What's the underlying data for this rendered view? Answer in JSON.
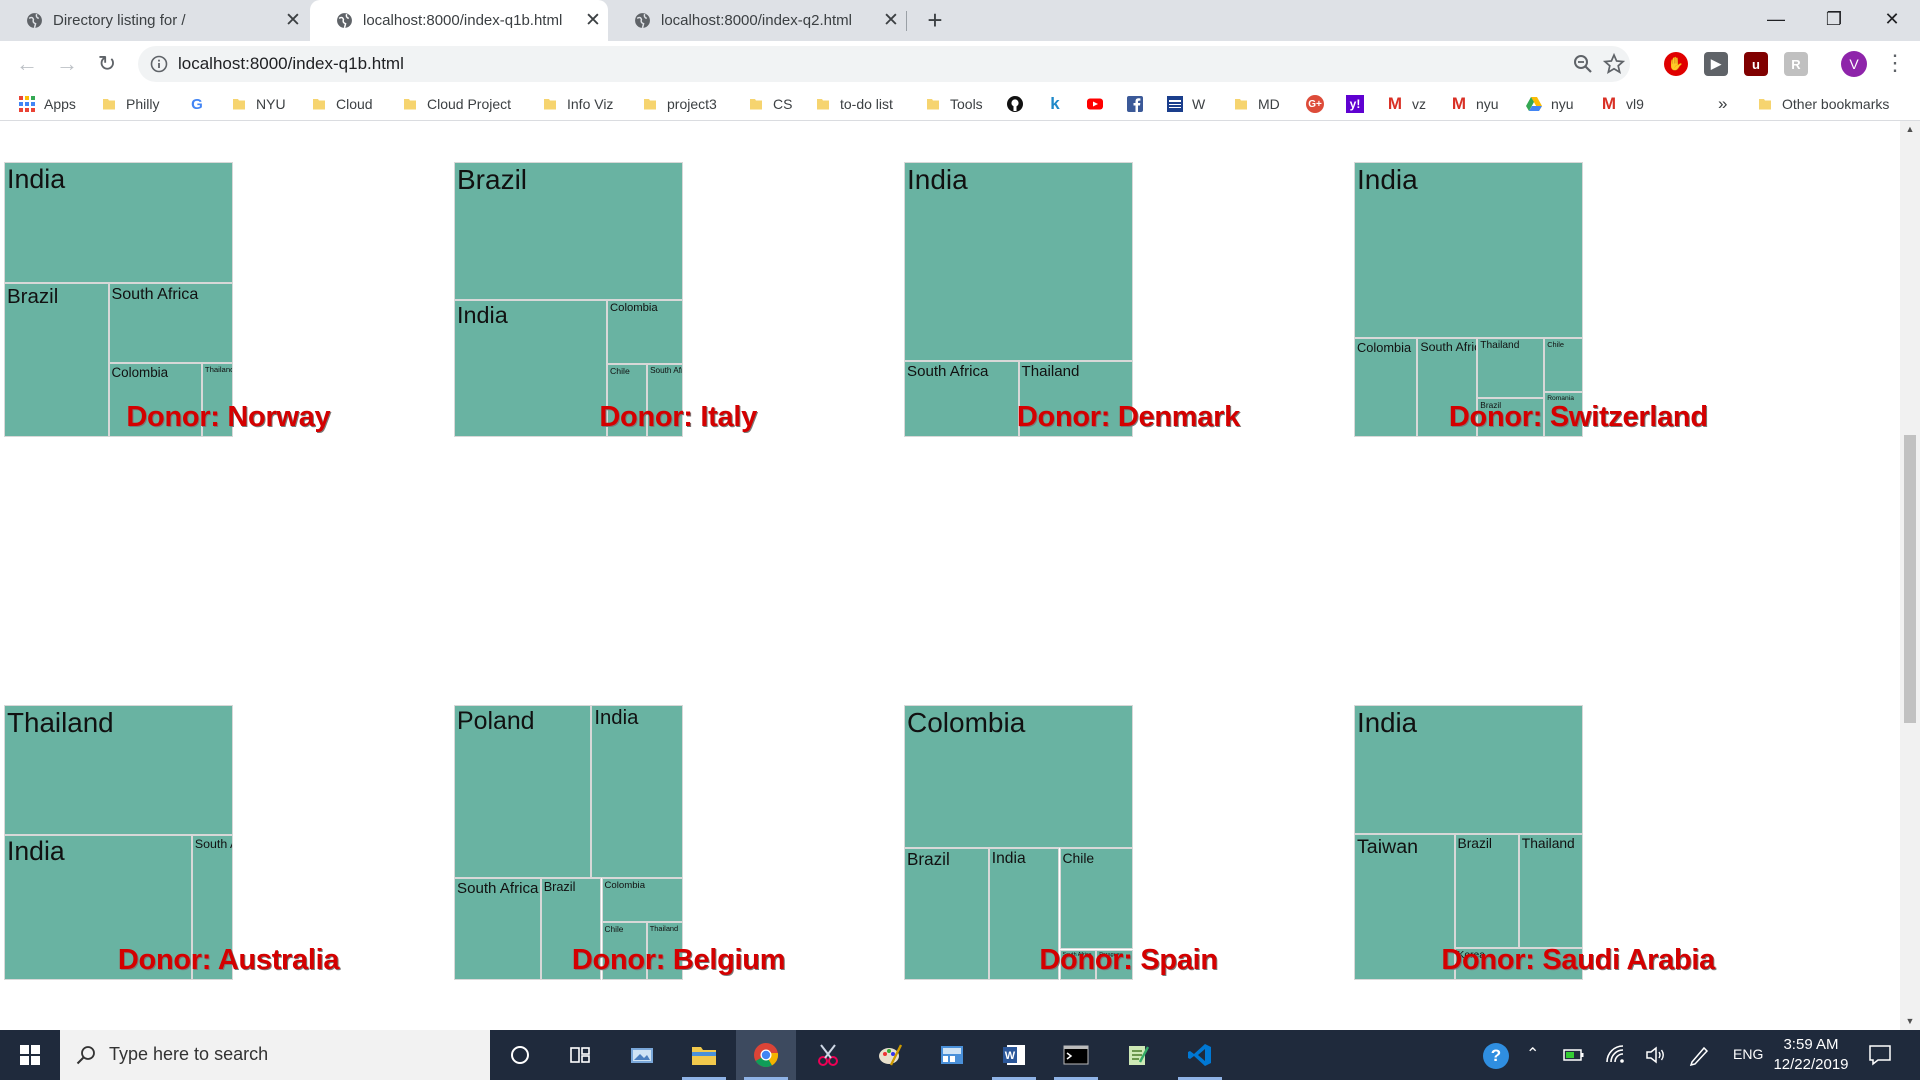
{
  "browser": {
    "tabs": [
      {
        "title": "Directory listing for /",
        "active": false
      },
      {
        "title": "localhost:8000/index-q1b.html",
        "active": true
      },
      {
        "title": "localhost:8000/index-q2.html",
        "active": false
      }
    ],
    "new_tab_label": "+",
    "url": "localhost:8000/index-q1b.html",
    "profile_initial": "V",
    "bookmarks": [
      {
        "label": "Apps",
        "icon": "apps-grid-icon"
      },
      {
        "label": "Philly",
        "icon": "folder-icon"
      },
      {
        "label": "",
        "icon": "google-icon"
      },
      {
        "label": "NYU",
        "icon": "folder-icon"
      },
      {
        "label": "Cloud",
        "icon": "folder-icon"
      },
      {
        "label": "Cloud Project",
        "icon": "folder-icon"
      },
      {
        "label": "Info Viz",
        "icon": "folder-icon"
      },
      {
        "label": "project3",
        "icon": "folder-icon"
      },
      {
        "label": "CS",
        "icon": "folder-icon"
      },
      {
        "label": "to-do list",
        "icon": "folder-icon"
      },
      {
        "label": "Tools",
        "icon": "folder-icon"
      },
      {
        "label": "",
        "icon": "github-icon"
      },
      {
        "label": "",
        "icon": "khan-icon"
      },
      {
        "label": "",
        "icon": "youtube-icon"
      },
      {
        "label": "",
        "icon": "facebook-icon"
      },
      {
        "label": "W",
        "icon": "news-icon"
      },
      {
        "label": "MD",
        "icon": "folder-icon"
      },
      {
        "label": "",
        "icon": "google-plus-icon"
      },
      {
        "label": "",
        "icon": "yahoo-icon"
      },
      {
        "label": "vz",
        "icon": "gmail-icon"
      },
      {
        "label": "nyu",
        "icon": "gmail-icon"
      },
      {
        "label": "nyu",
        "icon": "drive-icon"
      },
      {
        "label": "vl9",
        "icon": "gmail-icon"
      }
    ],
    "overflow_label": "»",
    "other_bookmarks": "Other bookmarks",
    "colors": {
      "tile": "#69b3a2",
      "donor_label": "#d40000",
      "tab_strip": "#dee1e6"
    }
  },
  "chart_data": [
    {
      "type": "treemap",
      "title": "Donor: Norway",
      "cells": [
        {
          "name": "South Africa",
          "value": 6.5
        },
        {
          "name": "Brazil",
          "value": 10.5
        },
        {
          "name": "India",
          "value": 18.0
        },
        {
          "name": "Thailand",
          "value": 1.5
        },
        {
          "name": "Colombia",
          "value": 4.5
        }
      ]
    },
    {
      "type": "treemap",
      "title": "Donor: Italy",
      "cells": [
        {
          "name": "Colombia",
          "value": 3.2
        },
        {
          "name": "Brazil",
          "value": 20.6
        },
        {
          "name": "India",
          "value": 13.7
        },
        {
          "name": "South Africa",
          "value": 1.7
        },
        {
          "name": "Chile",
          "value": 1.9
        }
      ]
    },
    {
      "type": "treemap",
      "title": "Donor: Denmark",
      "cells": [
        {
          "name": "South Africa",
          "value": 5.0
        },
        {
          "name": "India",
          "value": 26.0
        },
        {
          "name": "Thailand",
          "value": 5.0
        }
      ]
    },
    {
      "type": "treemap",
      "title": "Donor: Switzerland",
      "cells": [
        {
          "name": "Colombia",
          "value": 3.6
        },
        {
          "name": "South Africa",
          "value": 3.4
        },
        {
          "name": "India",
          "value": 23.0
        },
        {
          "name": "Brazil",
          "value": 1.5
        },
        {
          "name": "Chile",
          "value": 1.2
        },
        {
          "name": "Thailand",
          "value": 2.3
        },
        {
          "name": "Romania",
          "value": 1.0
        }
      ]
    },
    {
      "type": "treemap",
      "title": "Donor: Australia",
      "cells": [
        {
          "name": "Thailand",
          "value": 17.5
        },
        {
          "name": "South Africa",
          "value": 3.5
        },
        {
          "name": "India",
          "value": 16.0
        }
      ]
    },
    {
      "type": "treemap",
      "title": "Donor: Belgium",
      "cells": [
        {
          "name": "India",
          "value": 9.0
        },
        {
          "name": "Brazil",
          "value": 3.5
        },
        {
          "name": "South Africa",
          "value": 5.0
        },
        {
          "name": "Colombia",
          "value": 2.0
        },
        {
          "name": "Chile",
          "value": 1.5
        },
        {
          "name": "Thailand",
          "value": 1.2
        },
        {
          "name": "Poland",
          "value": 13.5
        }
      ]
    },
    {
      "type": "treemap",
      "title": "Donor: Spain",
      "cells": [
        {
          "name": "India",
          "value": 5.0
        },
        {
          "name": "Brazil",
          "value": 6.0
        },
        {
          "name": "Colombia",
          "value": 17.5
        },
        {
          "name": "Chile",
          "value": 4.0
        },
        {
          "name": "South Africa",
          "value": 0.6
        },
        {
          "name": "Paraguay",
          "value": 0.6
        }
      ]
    },
    {
      "type": "treemap",
      "title": "Donor: Saudi Arabia",
      "cells": [
        {
          "name": "India",
          "value": 18.0
        },
        {
          "name": "Brazil",
          "value": 4.5
        },
        {
          "name": "Taiwan",
          "value": 9.0
        },
        {
          "name": "Korea",
          "value": 2.5
        },
        {
          "name": "Thailand",
          "value": 4.5
        }
      ]
    }
  ],
  "taskbar": {
    "search_placeholder": "Type here to search",
    "language": "ENG",
    "time": "3:59 AM",
    "date": "12/22/2019"
  }
}
